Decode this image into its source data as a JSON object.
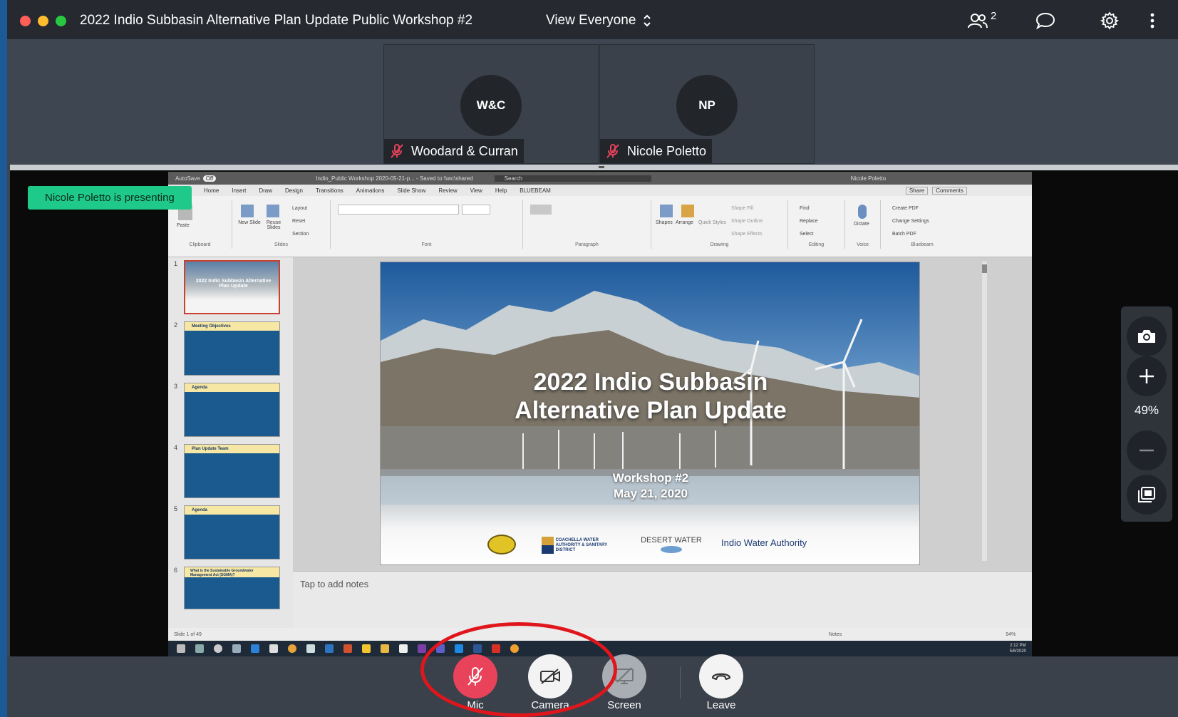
{
  "window": {
    "title": "2022 Indio Subbasin Alternative Plan Update Public Workshop #2",
    "view_label": "View Everyone",
    "participant_count": "2",
    "traffic_lights": {
      "close": "#ff5f57",
      "minimize": "#febc2e",
      "zoom": "#28c840"
    }
  },
  "participants": [
    {
      "initials": "W&C",
      "name": "Woodard & Curran",
      "muted": true
    },
    {
      "initials": "NP",
      "name": "Nicole Poletto",
      "muted": true
    }
  ],
  "presenting_badge": "Nicole Poletto is presenting",
  "shared_screen": {
    "app": "PowerPoint",
    "window_title": "Indio_Public Workshop 2020-05-21-p... - Saved to \\\\wc\\shared",
    "search_placeholder": "Search",
    "user_name": "Nicole Poletto",
    "autosave": "AutoSave",
    "autosave_state": "Off",
    "tabs": [
      "Home",
      "Insert",
      "Draw",
      "Design",
      "Transitions",
      "Animations",
      "Slide Show",
      "Review",
      "View",
      "Help",
      "BLUEBEAM"
    ],
    "share_btn": "Share",
    "comments_btn": "Comments",
    "ribbon_groups": [
      "Clipboard",
      "Slides",
      "Font",
      "Paragraph",
      "Drawing",
      "Editing",
      "Voice",
      "Bluebeam"
    ],
    "ribbon_buttons": {
      "paste": "Paste",
      "new_slide": "New Slide",
      "reuse_slides": "Reuse Slides",
      "layout": "Layout",
      "reset": "Reset",
      "section": "Section",
      "shapes": "Shapes",
      "arrange": "Arrange",
      "quick_styles": "Quick Styles",
      "shape_fill": "Shape Fill",
      "shape_outline": "Shape Outline",
      "shape_effects": "Shape Effects",
      "find": "Find",
      "replace": "Replace",
      "select": "Select",
      "dictate": "Dictate",
      "create_pdf": "Create PDF",
      "change_settings": "Change Settings",
      "batch_pdf": "Batch PDF"
    },
    "thumbnails": [
      {
        "num": "1",
        "title": "2022 Indio Subbasin Alternative Plan Update"
      },
      {
        "num": "2",
        "title": "Meeting Objectives"
      },
      {
        "num": "3",
        "title": "Agenda"
      },
      {
        "num": "4",
        "title": "Plan Update Team"
      },
      {
        "num": "5",
        "title": "Agenda"
      },
      {
        "num": "6",
        "title": "What is the Sustainable Groundwater Management Act (SGMA)?"
      }
    ],
    "slide": {
      "title_line1": "2022 Indio Subbasin",
      "title_line2": "Alternative Plan Update",
      "subtitle_line1": "Workshop #2",
      "subtitle_line2": "May 21, 2020",
      "logos": [
        "Coachella Valley Water District",
        "COACHELLA WATER AUTHORITY & SANITARY DISTRICT",
        "DESERT WATER",
        "Indio Water Authority"
      ]
    },
    "notes_placeholder": "Tap to add notes",
    "status_left": "Slide 1 of 49",
    "status_notes": "Notes",
    "status_zoom": "94%",
    "clock_time": "2:12 PM",
    "clock_date": "5/8/2020"
  },
  "zoom_panel": {
    "percent": "49%"
  },
  "controls": {
    "mic": "Mic",
    "camera": "Camera",
    "screen": "Screen",
    "leave": "Leave",
    "mic_color": "#e8435a"
  }
}
